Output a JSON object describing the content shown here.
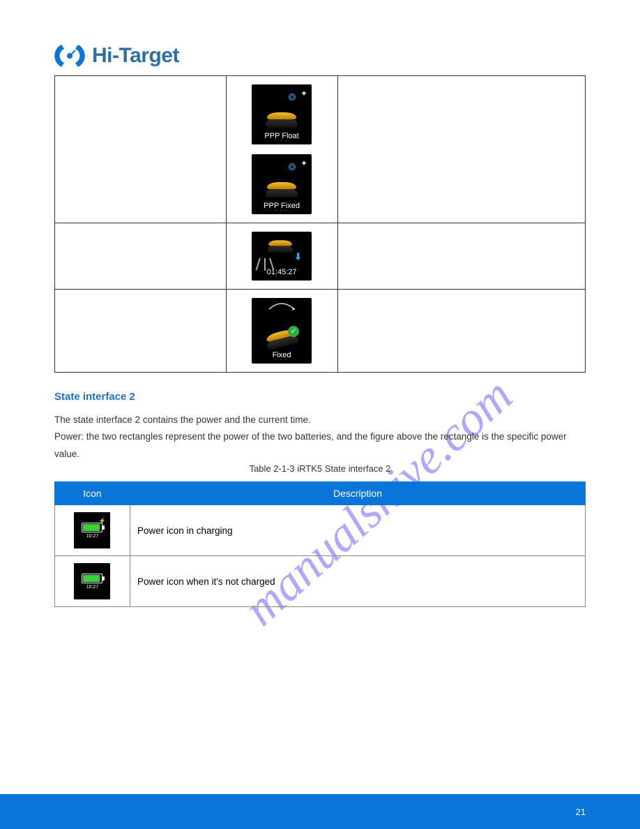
{
  "brand": "Hi-Target",
  "table1": {
    "rows": [
      {
        "thumb_labels": [
          "PPP Float",
          "PPP Fixed"
        ]
      },
      {
        "thumb_labels": [
          "01:45:27"
        ]
      },
      {
        "thumb_labels": [
          "Fixed"
        ]
      }
    ]
  },
  "section": {
    "heading": "State interface 2",
    "line1": "The state interface 2 contains the power and the current time.",
    "line2": "Power: the two rectangles represent the power of the two batteries, and the figure above the rectangle is the specific power value."
  },
  "table2_caption": "Table 2-1-3 iRTK5 State interface 2",
  "table2": {
    "headers": [
      "Icon",
      "Description"
    ],
    "rows": [
      {
        "time": "10:27",
        "desc": "Power icon in charging"
      },
      {
        "time": "10:27",
        "desc": "Power icon when it's not charged"
      }
    ]
  },
  "footer": "21",
  "watermark_text": "manualshive.com"
}
